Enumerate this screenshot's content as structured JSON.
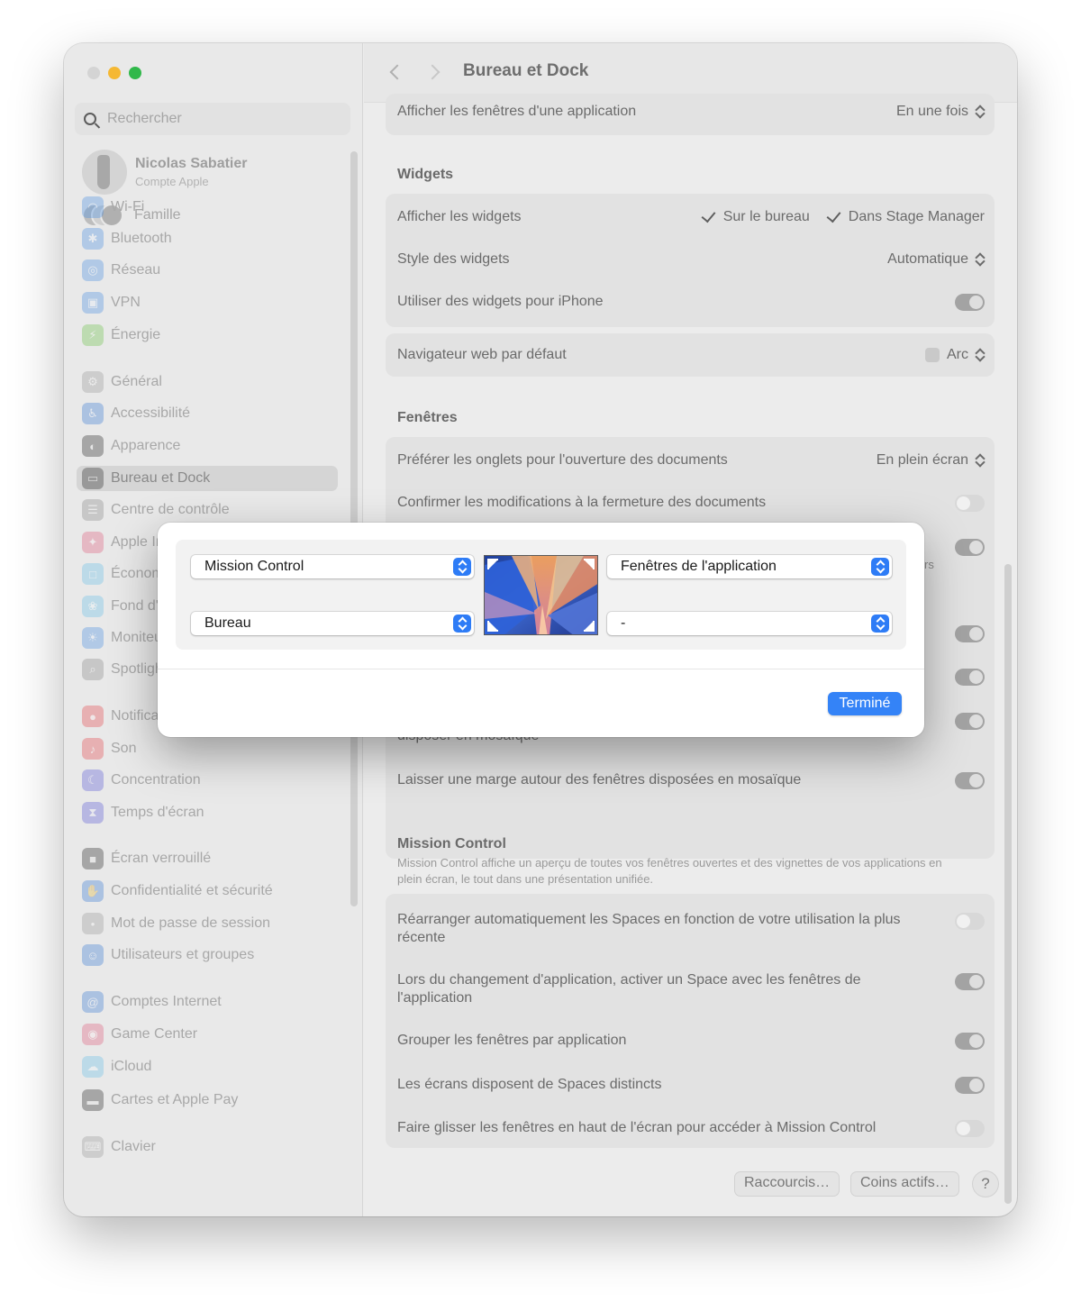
{
  "window": {
    "title": "Bureau et Dock"
  },
  "sidebar": {
    "search_placeholder": "Rechercher",
    "account": {
      "name": "Nicolas Sabatier",
      "subtitle": "Compte Apple"
    },
    "family_label": "Famille",
    "items": [
      {
        "label": "Wi-Fi",
        "icon": "wifi-icon",
        "color": "#4a90e2"
      },
      {
        "label": "Bluetooth",
        "icon": "bluetooth-icon",
        "color": "#4a90e2"
      },
      {
        "label": "Réseau",
        "icon": "network-icon",
        "color": "#4a90e2"
      },
      {
        "label": "VPN",
        "icon": "vpn-icon",
        "color": "#4a90e2"
      },
      {
        "label": "Énergie",
        "icon": "energy-icon",
        "color": "#6cc24a"
      },
      {
        "label": "Général",
        "icon": "gear-icon",
        "color": "#9a9a9a"
      },
      {
        "label": "Accessibilité",
        "icon": "accessibility-icon",
        "color": "#3a7bd5"
      },
      {
        "label": "Apparence",
        "icon": "appearance-icon",
        "color": "#2b2b2b"
      },
      {
        "label": "Bureau et Dock",
        "icon": "dock-icon",
        "color": "#2b2b2b"
      },
      {
        "label": "Centre de contrôle",
        "icon": "control-center-icon",
        "color": "#8a8a8a"
      },
      {
        "label": "Apple Intelligence et Siri",
        "icon": "siri-icon",
        "color": "#e0607e"
      },
      {
        "label": "Économiseur d'écran",
        "icon": "screensaver-icon",
        "color": "#6ac0e8"
      },
      {
        "label": "Fond d'écran",
        "icon": "wallpaper-icon",
        "color": "#6ac0e8"
      },
      {
        "label": "Moniteurs",
        "icon": "display-icon",
        "color": "#4a90e2"
      },
      {
        "label": "Spotlight",
        "icon": "spotlight-icon",
        "color": "#8a8a8a"
      },
      {
        "label": "Notifications",
        "icon": "bell-icon",
        "color": "#e5484d"
      },
      {
        "label": "Son",
        "icon": "sound-icon",
        "color": "#e5484d"
      },
      {
        "label": "Concentration",
        "icon": "moon-icon",
        "color": "#5b5bd6"
      },
      {
        "label": "Temps d'écran",
        "icon": "hourglass-icon",
        "color": "#5b5bd6"
      },
      {
        "label": "Écran verrouillé",
        "icon": "lock-icon",
        "color": "#2b2b2b"
      },
      {
        "label": "Confidentialité et sécurité",
        "icon": "hand-icon",
        "color": "#3a7bd5"
      },
      {
        "label": "Mot de passe de session",
        "icon": "password-icon",
        "color": "#9a9a9a"
      },
      {
        "label": "Utilisateurs et groupes",
        "icon": "users-icon",
        "color": "#3a7bd5"
      },
      {
        "label": "Comptes Internet",
        "icon": "at-icon",
        "color": "#3a7bd5"
      },
      {
        "label": "Game Center",
        "icon": "game-center-icon",
        "color": "#e0607e"
      },
      {
        "label": "iCloud",
        "icon": "cloud-icon",
        "color": "#6ac0e8"
      },
      {
        "label": "Cartes et Apple Pay",
        "icon": "wallet-icon",
        "color": "#2b2b2b"
      },
      {
        "label": "Clavier",
        "icon": "keyboard-icon",
        "color": "#9a9a9a"
      }
    ]
  },
  "settings": {
    "top_row": {
      "label": "Afficher les fenêtres d'une application",
      "value": "En une fois"
    },
    "widgets": {
      "title": "Widgets",
      "show_label": "Afficher les widgets",
      "check_desktop": "Sur le bureau",
      "check_stage": "Dans Stage Manager",
      "style_label": "Style des widgets",
      "style_value": "Automatique",
      "iphone_label": "Utiliser des widgets pour iPhone"
    },
    "browser": {
      "label": "Navigateur web par défaut",
      "value": "Arc"
    },
    "windows": {
      "title": "Fenêtres",
      "tabs_label": "Préférer les onglets pour l'ouverture des documents",
      "tabs_value": "En plein écran",
      "confirm_label": "Confirmer les modifications à la fermeture des documents",
      "partial_label": "disposer en mosaïque",
      "partial_suffix": "rs",
      "margin_label": "Laisser une marge autour des fenêtres disposées en mosaïque"
    },
    "mission_control": {
      "title": "Mission Control",
      "description": "Mission Control affiche un aperçu de toutes vos fenêtres ouvertes et des vignettes de vos applications en plein écran, le tout dans une présentation unifiée.",
      "rearrange_label": "Réarranger automatiquement les Spaces en fonction de votre utilisation la plus récente",
      "switch_label": "Lors du changement d'application, activer un Space avec les fenêtres de l'application",
      "group_label": "Grouper les fenêtres par application",
      "spaces_label": "Les écrans disposent de Spaces distincts",
      "drag_label": "Faire glisser les fenêtres en haut de l'écran pour accéder à Mission Control"
    },
    "buttons": {
      "shortcuts": "Raccourcis…",
      "hot_corners": "Coins actifs…",
      "help": "?"
    }
  },
  "modal": {
    "top_left": "Mission Control",
    "top_right": "Fenêtres de l'application",
    "bottom_left": "Bureau",
    "bottom_right": "-",
    "done": "Terminé"
  },
  "colors": {
    "accent": "#3483f7",
    "done_button": "#3483f7"
  }
}
